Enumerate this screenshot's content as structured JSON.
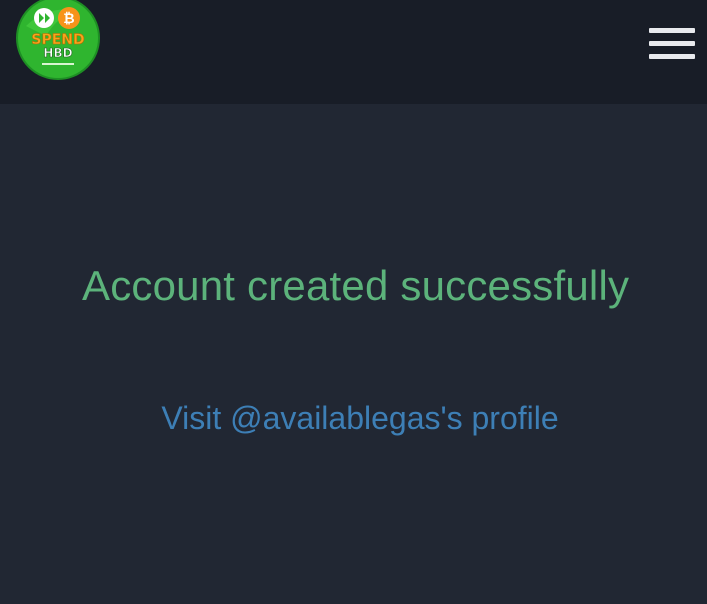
{
  "header": {
    "logo": {
      "text_line1": "SPEND",
      "text_line2": "HBD",
      "icon": "spendhbd-logo-icon"
    },
    "menu_icon": "hamburger-menu-icon"
  },
  "main": {
    "heading": "Account created successfully",
    "profile_link": "Visit @availablegas's profile"
  },
  "colors": {
    "header_bg": "#181d27",
    "page_bg": "#212733",
    "heading": "#5cb37b",
    "link": "#3d7fb6",
    "logo_green": "#2fb52f",
    "logo_orange": "#f7931a"
  }
}
